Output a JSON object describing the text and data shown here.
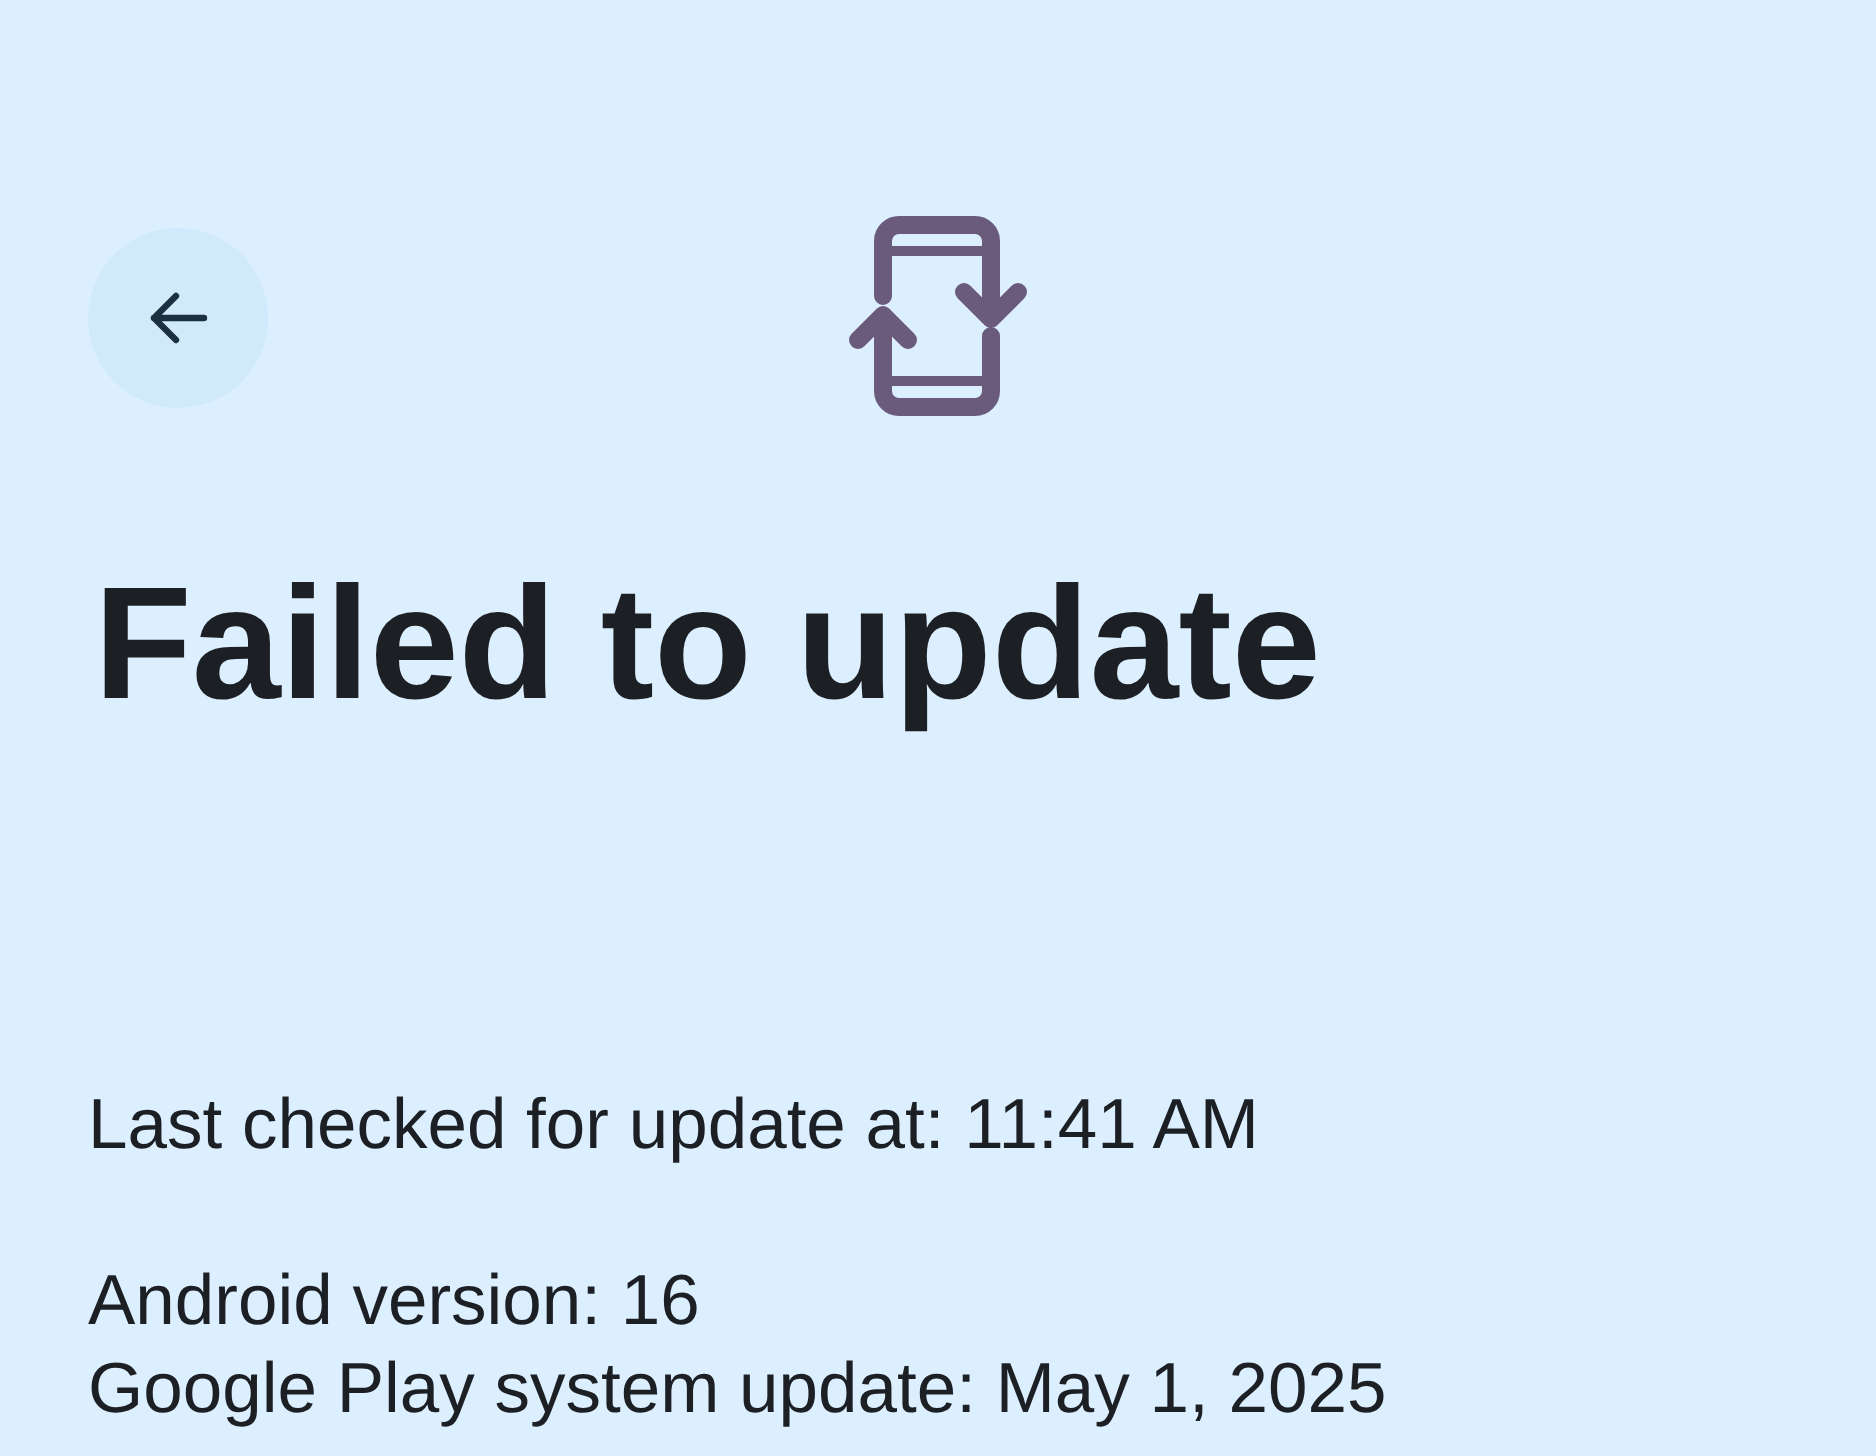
{
  "title": "Failed to update",
  "sections": [
    {
      "lines": [
        "Last checked for update at: 11:41 AM"
      ]
    },
    {
      "lines": [
        "Android version: 16",
        "Google Play system update: May 1, 2025"
      ]
    }
  ]
}
